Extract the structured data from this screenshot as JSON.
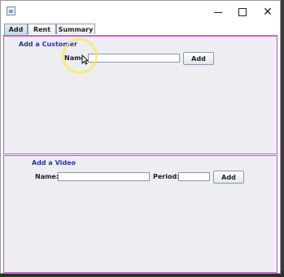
{
  "window": {
    "icon": "java-app-icon",
    "controls": [
      "minimize-icon",
      "maximize-icon",
      "close-icon"
    ],
    "close_glyph": "✕"
  },
  "tabs": [
    {
      "label": "Add",
      "active": true
    },
    {
      "label": "Rent",
      "active": false
    },
    {
      "label": "Summary",
      "active": false
    }
  ],
  "customer_section": {
    "title": "Add a Customer",
    "name_label": "Name",
    "name_value": "",
    "add_label": "Add"
  },
  "video_section": {
    "title": "Add a Video",
    "name_label": "Name:",
    "name_value": "",
    "period_label": "Period:",
    "period_value": "",
    "add_label": "Add"
  },
  "colors": {
    "section_title": "#2a35b0",
    "panel_border": "#c44fd6",
    "panel_background": "#eeedf1"
  }
}
